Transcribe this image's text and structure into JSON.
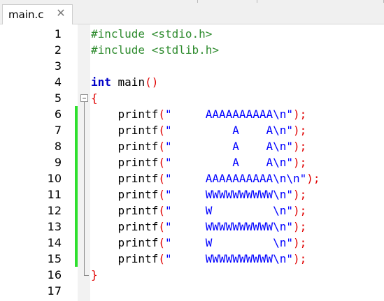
{
  "tab": {
    "filename": "main.c",
    "close_glyph": "✕"
  },
  "colors": {
    "preprocessor": "#2e8b2e",
    "keyword": "#0000c8",
    "operator": "#e00000",
    "string": "#0000ff",
    "change_marker": "#2ee02e"
  },
  "lines": [
    {
      "n": "1",
      "tokens": [
        [
          "pre",
          "#include <stdio.h>"
        ]
      ]
    },
    {
      "n": "2",
      "tokens": [
        [
          "pre",
          "#include <stdlib.h>"
        ]
      ]
    },
    {
      "n": "3",
      "tokens": []
    },
    {
      "n": "4",
      "tokens": [
        [
          "kw",
          "int"
        ],
        [
          "fn",
          " main"
        ],
        [
          "op",
          "()"
        ]
      ]
    },
    {
      "n": "5",
      "tokens": [
        [
          "op",
          "{"
        ]
      ]
    },
    {
      "n": "6",
      "tokens": [
        [
          "fn",
          "    printf"
        ],
        [
          "op",
          "("
        ],
        [
          "str",
          "\"     AAAAAAAAAA\\n\""
        ],
        [
          "op",
          ");"
        ]
      ]
    },
    {
      "n": "7",
      "tokens": [
        [
          "fn",
          "    printf"
        ],
        [
          "op",
          "("
        ],
        [
          "str",
          "\"         A    A\\n\""
        ],
        [
          "op",
          ");"
        ]
      ]
    },
    {
      "n": "8",
      "tokens": [
        [
          "fn",
          "    printf"
        ],
        [
          "op",
          "("
        ],
        [
          "str",
          "\"         A    A\\n\""
        ],
        [
          "op",
          ");"
        ]
      ]
    },
    {
      "n": "9",
      "tokens": [
        [
          "fn",
          "    printf"
        ],
        [
          "op",
          "("
        ],
        [
          "str",
          "\"         A    A\\n\""
        ],
        [
          "op",
          ");"
        ]
      ]
    },
    {
      "n": "10",
      "tokens": [
        [
          "fn",
          "    printf"
        ],
        [
          "op",
          "("
        ],
        [
          "str",
          "\"     AAAAAAAAAA\\n\\n\""
        ],
        [
          "op",
          ");"
        ]
      ]
    },
    {
      "n": "11",
      "tokens": [
        [
          "fn",
          "    printf"
        ],
        [
          "op",
          "("
        ],
        [
          "str",
          "\"     WWWWWWWWWW\\n\""
        ],
        [
          "op",
          ");"
        ]
      ]
    },
    {
      "n": "12",
      "tokens": [
        [
          "fn",
          "    printf"
        ],
        [
          "op",
          "("
        ],
        [
          "str",
          "\"     W         \\n\""
        ],
        [
          "op",
          ");"
        ]
      ]
    },
    {
      "n": "13",
      "tokens": [
        [
          "fn",
          "    printf"
        ],
        [
          "op",
          "("
        ],
        [
          "str",
          "\"     WWWWWWWWWW\\n\""
        ],
        [
          "op",
          ");"
        ]
      ]
    },
    {
      "n": "14",
      "tokens": [
        [
          "fn",
          "    printf"
        ],
        [
          "op",
          "("
        ],
        [
          "str",
          "\"     W         \\n\""
        ],
        [
          "op",
          ");"
        ]
      ]
    },
    {
      "n": "15",
      "tokens": [
        [
          "fn",
          "    printf"
        ],
        [
          "op",
          "("
        ],
        [
          "str",
          "\"     WWWWWWWWWW\\n\""
        ],
        [
          "op",
          ");"
        ]
      ]
    },
    {
      "n": "16",
      "tokens": [
        [
          "op",
          "}"
        ]
      ]
    },
    {
      "n": "17",
      "tokens": []
    }
  ],
  "changed_lines": [
    "6",
    "7",
    "8",
    "9",
    "10",
    "11",
    "12",
    "13",
    "14",
    "15"
  ]
}
